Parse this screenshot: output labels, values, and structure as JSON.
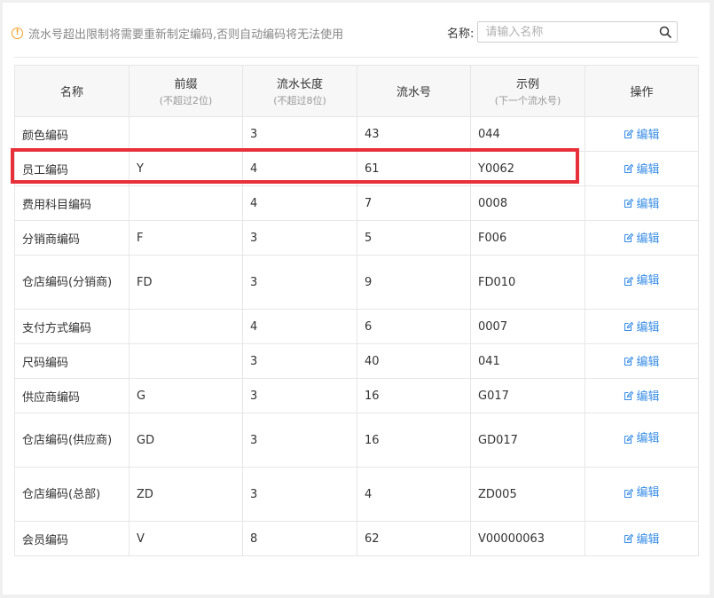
{
  "notice": {
    "text": "流水号超出限制将需要重新制定编码,否则自动编码将无法使用"
  },
  "search": {
    "label": "名称:",
    "placeholder": "请输入名称"
  },
  "table": {
    "headers": {
      "name": "名称",
      "prefix": "前缀",
      "prefix_note": "(不超过2位)",
      "length": "流水长度",
      "length_note": "(不超过8位)",
      "serial": "流水号",
      "example": "示例",
      "example_note": "(下一个流水号)",
      "action": "操作"
    },
    "edit_label": "编辑",
    "rows": [
      {
        "name": "颜色编码",
        "prefix": "",
        "length": "3",
        "serial": "43",
        "example": "044"
      },
      {
        "name": "员工编码",
        "prefix": "Y",
        "length": "4",
        "serial": "61",
        "example": "Y0062"
      },
      {
        "name": "费用科目编码",
        "prefix": "",
        "length": "4",
        "serial": "7",
        "example": "0008"
      },
      {
        "name": "分销商编码",
        "prefix": "F",
        "length": "3",
        "serial": "5",
        "example": "F006"
      },
      {
        "name": "仓店编码(分销商)",
        "prefix": "FD",
        "length": "3",
        "serial": "9",
        "example": "FD010"
      },
      {
        "name": "支付方式编码",
        "prefix": "",
        "length": "4",
        "serial": "6",
        "example": "0007"
      },
      {
        "name": "尺码编码",
        "prefix": "",
        "length": "3",
        "serial": "40",
        "example": "041"
      },
      {
        "name": "供应商编码",
        "prefix": "G",
        "length": "3",
        "serial": "16",
        "example": "G017"
      },
      {
        "name": "仓店编码(供应商)",
        "prefix": "GD",
        "length": "3",
        "serial": "16",
        "example": "GD017"
      },
      {
        "name": "仓店编码(总部)",
        "prefix": "ZD",
        "length": "3",
        "serial": "4",
        "example": "ZD005"
      },
      {
        "name": "会员编码",
        "prefix": "V",
        "length": "8",
        "serial": "62",
        "example": "V00000063"
      }
    ]
  },
  "colors": {
    "accent": "#3a8ee6",
    "highlight": "#e8303a",
    "warning": "#f0a020"
  },
  "icons": {
    "notice": "warning-circle-icon",
    "search": "search-icon",
    "edit": "edit-icon"
  }
}
